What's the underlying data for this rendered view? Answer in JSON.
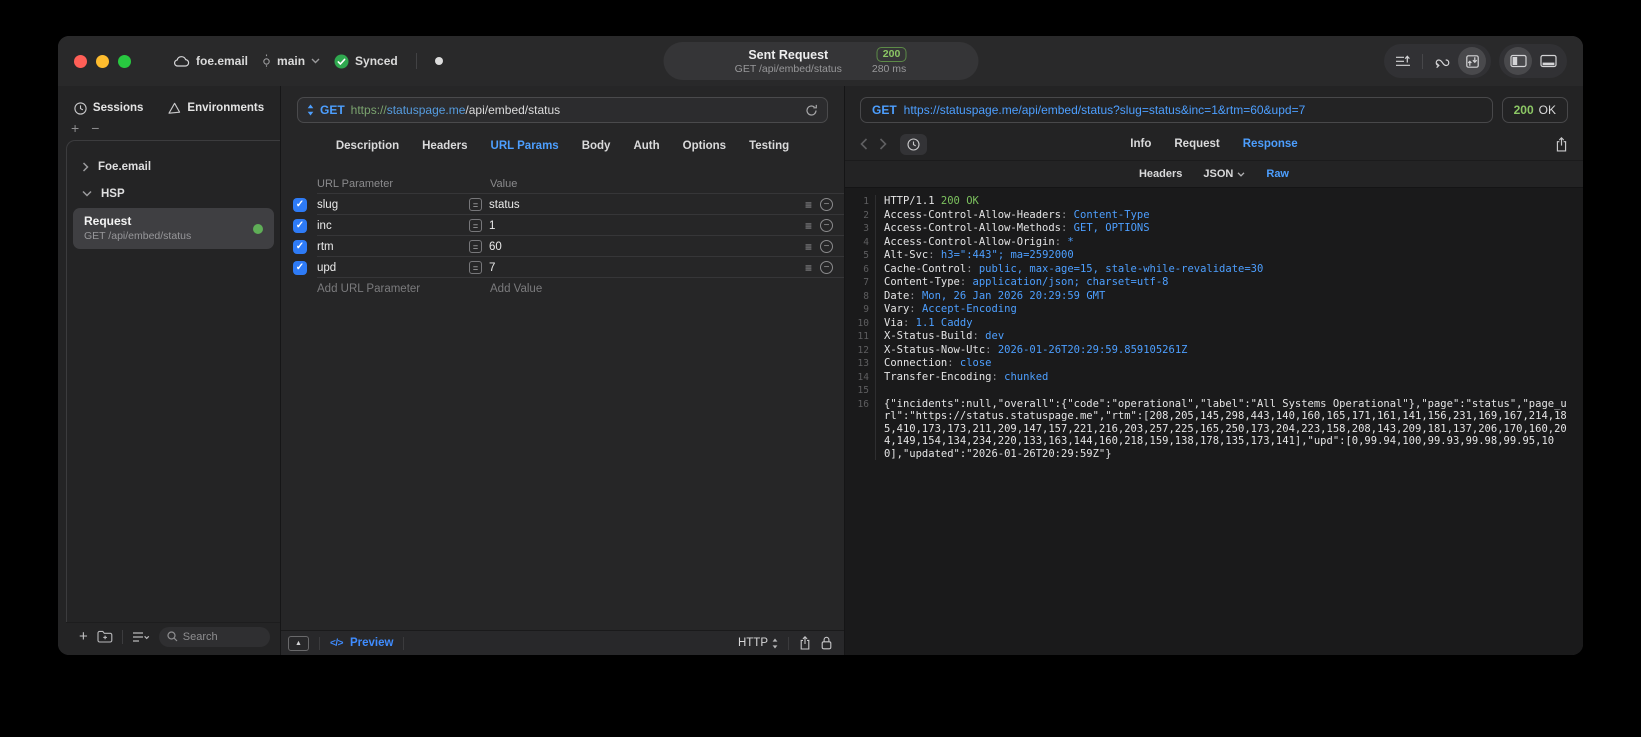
{
  "colors": {
    "accent_blue": "#4D9FFF",
    "success_green": "#7CC15E",
    "status_green": "#8CC765",
    "checkbox_blue": "#2E7BF6",
    "url_scheme_green": "#7BA36F",
    "url_host_blue": "#569CDF"
  },
  "titlebar": {
    "project": "foe.email",
    "branch": "main",
    "sync_label": "Synced",
    "title": "Sent Request",
    "subtitle": "GET /api/embed/status",
    "status_code": "200",
    "duration": "280 ms"
  },
  "sidebar": {
    "tabs": [
      {
        "label": "Sessions"
      },
      {
        "label": "Environments"
      }
    ],
    "tree_items": [
      {
        "label": "Foe.email",
        "state": "collapsed"
      },
      {
        "label": "HSP",
        "state": "expanded"
      }
    ],
    "request_item": {
      "title": "Request",
      "subtitle": "GET /api/embed/status"
    },
    "search_placeholder": "Search"
  },
  "request": {
    "method": "GET",
    "url": {
      "scheme": "https://",
      "host": "statuspage.me",
      "path": "/api/embed/status"
    },
    "tabs": [
      "Description",
      "Headers",
      "URL Params",
      "Body",
      "Auth",
      "Options",
      "Testing"
    ],
    "active_tab": "URL Params",
    "params": {
      "col_param": "URL Parameter",
      "col_value": "Value",
      "rows": [
        {
          "name": "slug",
          "value": "status",
          "checked": true
        },
        {
          "name": "inc",
          "value": "1",
          "checked": true
        },
        {
          "name": "rtm",
          "value": "60",
          "checked": true
        },
        {
          "name": "upd",
          "value": "7",
          "checked": true
        }
      ],
      "add_param": "Add URL Parameter",
      "add_value": "Add Value"
    },
    "footer": {
      "preview": "Preview",
      "code_glyph": "</>",
      "protocol": "HTTP"
    }
  },
  "response": {
    "method": "GET",
    "url": "https://statuspage.me/api/embed/status?slug=status&inc=1&rtm=60&upd=7",
    "status_code": "200",
    "status_reason": "OK",
    "tabs": [
      "Info",
      "Request",
      "Response"
    ],
    "active_tab": "Response",
    "subtabs": [
      "Headers",
      "JSON",
      "Raw"
    ],
    "active_subtab": "Raw",
    "status_line": {
      "protocol": "HTTP/1.1",
      "status": "200 OK"
    },
    "headers": [
      {
        "name": "Access-Control-Allow-Headers",
        "value": "Content-Type"
      },
      {
        "name": "Access-Control-Allow-Methods",
        "value": "GET, OPTIONS"
      },
      {
        "name": "Access-Control-Allow-Origin",
        "value": "*"
      },
      {
        "name": "Alt-Svc",
        "value": "h3=\":443\"; ma=2592000"
      },
      {
        "name": "Cache-Control",
        "value": "public, max-age=15, stale-while-revalidate=30"
      },
      {
        "name": "Content-Type",
        "value": "application/json; charset=utf-8"
      },
      {
        "name": "Date",
        "value": "Mon, 26 Jan 2026 20:29:59 GMT"
      },
      {
        "name": "Vary",
        "value": "Accept-Encoding"
      },
      {
        "name": "Via",
        "value": "1.1 Caddy"
      },
      {
        "name": "X-Status-Build",
        "value": "dev"
      },
      {
        "name": "X-Status-Now-Utc",
        "value": "2026-01-26T20:29:59.859105261Z"
      },
      {
        "name": "Connection",
        "value": "close"
      },
      {
        "name": "Transfer-Encoding",
        "value": "chunked"
      }
    ],
    "body_json": {
      "incidents": null,
      "overall": {
        "code": "operational",
        "label": "All Systems Operational"
      },
      "page": "status",
      "page_url": "https://status.statuspage.me",
      "rtm": [
        208,
        205,
        145,
        298,
        443,
        140,
        160,
        165,
        171,
        161,
        141,
        156,
        231,
        169,
        167,
        214,
        185,
        410,
        173,
        173,
        211,
        209,
        147,
        157,
        221,
        216,
        203,
        257,
        225,
        165,
        250,
        173,
        204,
        223,
        158,
        208,
        143,
        209,
        181,
        137,
        206,
        170,
        160,
        204,
        149,
        154,
        134,
        234,
        220,
        133,
        163,
        144,
        160,
        218,
        159,
        138,
        178,
        135,
        173,
        141
      ],
      "upd": [
        0,
        99.94,
        100,
        99.93,
        99.98,
        99.95,
        100
      ],
      "updated": "2026-01-26T20:29:59Z"
    }
  }
}
